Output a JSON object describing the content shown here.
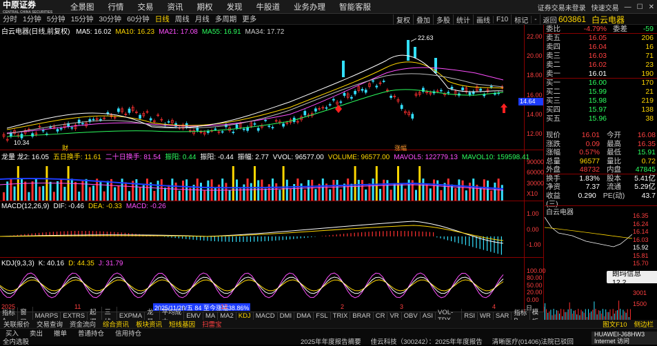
{
  "topbar": {
    "logo": "中原证券",
    "logo_sub": "CENTRAL CHINA SECURITIES",
    "menu": [
      "全景图",
      "行情",
      "交易",
      "资讯",
      "期权",
      "发现",
      "牛股道",
      "业务办理",
      "智能客服"
    ],
    "status": "证券交易未登录",
    "quick_trade": "快速交易"
  },
  "periods": [
    "分时",
    "1分钟",
    "5分钟",
    "15分钟",
    "30分钟",
    "60分钟",
    "日线",
    "周线",
    "月线",
    "多周期",
    "更多"
  ],
  "active_period": "日线",
  "tools": [
    "复权",
    "叠加",
    "多股",
    "统计",
    "画线",
    "F10",
    "标记",
    "-",
    "返回"
  ],
  "stock": {
    "code": "603861",
    "name": "白云电器"
  },
  "main_chart": {
    "title": "白云电器(日线,前复权)",
    "ma_legend": [
      {
        "label": "MA5: 16.02",
        "color": "#ffffff"
      },
      {
        "label": "MA10: 16.23",
        "color": "#ffd700"
      },
      {
        "label": "MA21: 17.08",
        "color": "#ff4fff"
      },
      {
        "label": "MA55: 16.91",
        "color": "#2cff5f"
      },
      {
        "label": "MA34: 17.72",
        "color": "#cccccc"
      }
    ],
    "high_label": "22.63",
    "low_label": "10.34",
    "price_tag": "14.64",
    "axis": [
      "22.00",
      "20.00",
      "18.00",
      "16.00",
      "14.00",
      "12.00"
    ],
    "markers": [
      "财",
      "涨幅"
    ]
  },
  "volume_chart": {
    "legend": [
      {
        "label": "龙量 龙2: 16.05",
        "color": "#ffffff"
      },
      {
        "label": "五日换手: 11.61",
        "color": "#ffd700"
      },
      {
        "label": "二十日换手: 81.54",
        "color": "#ff4fff"
      },
      {
        "label": "振阳: 0.44",
        "color": "#2cff5f"
      },
      {
        "label": "振阳: -0.44",
        "color": "#ffffff"
      },
      {
        "label": "振幅: 2.77",
        "color": "#ffffff"
      },
      {
        "label": "VVOL: 96577.00",
        "color": "#ffffff"
      },
      {
        "label": "VOLUME: 96577.00",
        "color": "#ffd700"
      },
      {
        "label": "MAVOL5: 122779.13",
        "color": "#ff4fff"
      },
      {
        "label": "MAVOL10: 159598.41",
        "color": "#2cff5f"
      }
    ],
    "axis": [
      "90000",
      "60000",
      "30000",
      "X10"
    ]
  },
  "macd_chart": {
    "legend": [
      {
        "label": "MACD(12,26,9)",
        "color": "#ffffff"
      },
      {
        "label": "DIF: -0.46",
        "color": "#ffffff"
      },
      {
        "label": "DEA: -0.33",
        "color": "#ffd700"
      },
      {
        "label": "MACD: -0.26",
        "color": "#ff4fff"
      }
    ],
    "axis": [
      "1.00",
      "0.00",
      "-1.00"
    ]
  },
  "kdj_chart": {
    "legend": [
      {
        "label": "KDJ(9,3,3)",
        "color": "#ffffff"
      },
      {
        "label": "K: 40.16",
        "color": "#ffffff"
      },
      {
        "label": "D: 44.35",
        "color": "#ffd700"
      },
      {
        "label": "J: 31.79",
        "color": "#ff4fff"
      }
    ],
    "axis": [
      "100.00",
      "80.00",
      "50.00",
      "20.00",
      "0.00"
    ]
  },
  "time_axis": {
    "year": "2025",
    "ticks": [
      "11",
      "12",
      "2",
      "3",
      "4"
    ],
    "hover": "2025/11/28/五 84 至今涨幅38.86%",
    "right": "日线"
  },
  "orderbook": [
    {
      "label": "委比",
      "price": "-4.79%",
      "extra": "委差",
      "vol": "-59"
    },
    {
      "label": "卖五",
      "price": "16.05",
      "vol": "206"
    },
    {
      "label": "卖四",
      "price": "16.04",
      "vol": "16"
    },
    {
      "label": "卖三",
      "price": "16.03",
      "vol": "71"
    },
    {
      "label": "卖二",
      "price": "16.02",
      "vol": "23"
    },
    {
      "label": "卖一",
      "price": "16.01",
      "vol": "190"
    },
    {
      "label": "买一",
      "price": "16.00",
      "vol": "170"
    },
    {
      "label": "买二",
      "price": "15.99",
      "vol": "21"
    },
    {
      "label": "买三",
      "price": "15.98",
      "vol": "219"
    },
    {
      "label": "买四",
      "price": "15.97",
      "vol": "138"
    },
    {
      "label": "买五",
      "price": "15.96",
      "vol": "38"
    }
  ],
  "quote": [
    [
      "现价",
      "16.01",
      "今开",
      "16.08"
    ],
    [
      "涨跌",
      "0.09",
      "最高",
      "16.35"
    ],
    [
      "涨幅",
      "0.57%",
      "最低",
      "15.91"
    ],
    [
      "总量",
      "96577",
      "量比",
      "0.72"
    ],
    [
      "外盘",
      "48732",
      "内盘",
      "47845"
    ],
    [
      "换手",
      "1.83%",
      "股本",
      "5.41亿"
    ],
    [
      "净资",
      "7.37",
      "流通",
      "5.29亿"
    ],
    [
      "收益(三)",
      "0.290",
      "PE(动)",
      "43.7"
    ]
  ],
  "minichart": {
    "title": "白云电器",
    "axis": [
      "16.35",
      "16.24",
      "16.14",
      "16.03",
      "15.92",
      "15.81",
      "15.70"
    ],
    "vol_axis": [
      "3001",
      "1500"
    ]
  },
  "toast": "朗玛信息 12.2",
  "bottom_tabs": [
    "指标A",
    "窗口",
    "MARPS",
    "EXTRS",
    "起爆",
    "三线",
    "EXPMA",
    "龙量",
    "平均成本",
    "EMV",
    "MA",
    "MA2",
    "KDJ",
    "MACD",
    "DMI",
    "DMA",
    "FSL",
    "TRIX",
    "BRAR",
    "CR",
    "VR",
    "OBV",
    "ASI",
    "VOL-TDX",
    "RSI",
    "WR",
    "SAR",
    "指标B",
    "模板"
  ],
  "active_bottom": "KDJ",
  "funcbar": [
    "买入",
    "卖出",
    "撤单",
    "普通持仓",
    "信用持仓"
  ],
  "funcbar2": [
    "关联报价",
    "交易查询",
    "资金流向",
    "综合资讯",
    "板块资讯",
    "短线基因",
    "扫雷宝"
  ],
  "funcbar_right": [
    "图文F10",
    "侧边栏"
  ],
  "infobar": {
    "left": "全内选股",
    "ticker1": "2025年年度报告摘要",
    "ticker2": "佳云科技（300242）：2025年年度报告",
    "ticker3": "清晰医疗(01406)法院已驳回",
    "brand": "HUAWEI-J68HW3",
    "brand2": "Internet 访问"
  }
}
